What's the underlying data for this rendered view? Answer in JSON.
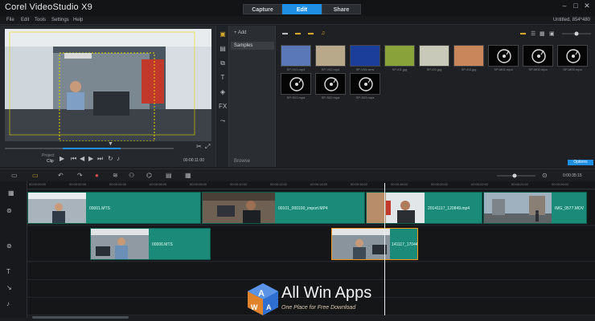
{
  "app": {
    "title": "Corel VideoStudio X9",
    "project": "Untitled, 854*480"
  },
  "tabs": [
    {
      "label": "Capture"
    },
    {
      "label": "Edit"
    },
    {
      "label": "Share"
    }
  ],
  "menu": [
    {
      "label": "File"
    },
    {
      "label": "Edit"
    },
    {
      "label": "Tools"
    },
    {
      "label": "Settings"
    },
    {
      "label": "Help"
    }
  ],
  "player": {
    "project_label": "Project",
    "clip_label": "Clip",
    "timecode": "00:00:11:00"
  },
  "library": {
    "add_label": "Add",
    "folder": "Samples",
    "browse_label": "Browse",
    "options_label": "Options",
    "items": [
      {
        "caption": "SP-V01.mp4",
        "color": "#5a78b8"
      },
      {
        "caption": "SP-V02.mp4",
        "color": "#b9a98b"
      },
      {
        "caption": "SP-V04.wmv",
        "color": "#1a3e9a"
      },
      {
        "caption": "SP-I01.jpg",
        "color": "#8aa23a"
      },
      {
        "caption": "SP-I02.jpg",
        "color": "#c8c9b8"
      },
      {
        "caption": "SP-I03.jpg",
        "color": "#c9865a"
      },
      {
        "caption": "SP-M01.mpa",
        "color": "#050505"
      },
      {
        "caption": "SP-M02.mpa",
        "color": "#050505"
      },
      {
        "caption": "SP-M03.mpa",
        "color": "#050505"
      },
      {
        "caption": "SP-S01.mpa",
        "color": "#050505"
      },
      {
        "caption": "SP-S02.mpa",
        "color": "#050505"
      },
      {
        "caption": "SP-S03.mpa",
        "color": "#050505"
      }
    ]
  },
  "timeline": {
    "ticks": [
      "00:00:00:00",
      "00:00:02:00",
      "00:00:04:00",
      "00:00:06:00",
      "00:00:08:00",
      "00:00:10:02",
      "00:00:12:02",
      "00:00:14:02",
      "00:00:16:02",
      "00:00:18:02",
      "00:00:20:02",
      "00:00:22:02",
      "00:00:24:02",
      "00:00:26:02"
    ],
    "duration": "0:00:35:15",
    "video_clips": [
      {
        "name": "00001.MTS"
      },
      {
        "name": "00101_000100_import.MP4"
      },
      {
        "name": "20141117_120849.mp4"
      },
      {
        "name": "IMG_0577.MOV"
      }
    ],
    "overlay_clips": [
      {
        "name": "00006.MTS"
      },
      {
        "name": "141117_17044"
      }
    ]
  },
  "watermark": {
    "title": "All Win Apps",
    "tagline": "One Place for Free Download"
  }
}
